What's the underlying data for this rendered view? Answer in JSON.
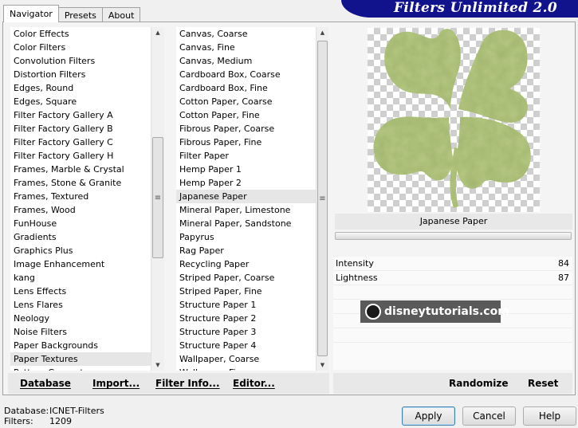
{
  "tabs": [
    {
      "label": "Navigator"
    },
    {
      "label": "Presets"
    },
    {
      "label": "About"
    }
  ],
  "app_title": "Filters Unlimited 2.0",
  "categories": [
    "Color Effects",
    "Color Filters",
    "Convolution Filters",
    "Distortion Filters",
    "Edges, Round",
    "Edges, Square",
    "Filter Factory Gallery A",
    "Filter Factory Gallery B",
    "Filter Factory Gallery C",
    "Filter Factory Gallery H",
    "Frames, Marble & Crystal",
    "Frames, Stone & Granite",
    "Frames, Textured",
    "Frames, Wood",
    "FunHouse",
    "Gradients",
    "Graphics Plus",
    "Image Enhancement",
    "kang",
    "Lens Effects",
    "Lens Flares",
    "Neology",
    "Noise Filters",
    "Paper Backgrounds",
    "Paper Textures",
    "Pattern Generators"
  ],
  "selected_category": "Paper Textures",
  "filters": [
    "Canvas, Coarse",
    "Canvas, Fine",
    "Canvas, Medium",
    "Cardboard Box, Coarse",
    "Cardboard Box, Fine",
    "Cotton Paper, Coarse",
    "Cotton Paper, Fine",
    "Fibrous Paper, Coarse",
    "Fibrous Paper, Fine",
    "Filter Paper",
    "Hemp Paper 1",
    "Hemp Paper 2",
    "Japanese Paper",
    "Mineral Paper, Limestone",
    "Mineral Paper, Sandstone",
    "Papyrus",
    "Rag Paper",
    "Recycling Paper",
    "Striped Paper, Coarse",
    "Striped Paper, Fine",
    "Structure Paper 1",
    "Structure Paper 2",
    "Structure Paper 3",
    "Structure Paper 4",
    "Wallpaper, Coarse",
    "Wallpaper, Fine"
  ],
  "selected_filter": "Japanese Paper",
  "preview": {
    "filter_label": "Japanese Paper",
    "shape_color": "#b6c983"
  },
  "params": [
    {
      "name": "Intensity",
      "value": "84"
    },
    {
      "name": "Lightness",
      "value": "87"
    }
  ],
  "watermark": "disneytutorials.com",
  "toolbar": {
    "database": "Database",
    "import": "Import...",
    "filter_info": "Filter Info...",
    "editor": "Editor...",
    "randomize": "Randomize",
    "reset": "Reset"
  },
  "status": {
    "database_label": "Database:",
    "database_value": "ICNET-Filters",
    "filters_label": "Filters:",
    "filters_value": "1209"
  },
  "buttons": {
    "apply": "Apply",
    "cancel": "Cancel",
    "help": "Help"
  },
  "colors": {
    "title_bar": "#10138c"
  }
}
